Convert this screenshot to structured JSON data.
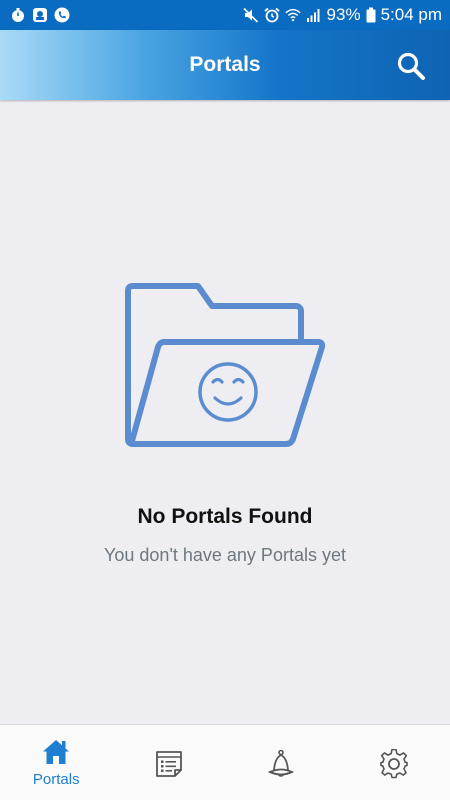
{
  "status_bar": {
    "battery": "93%",
    "time": "5:04 pm"
  },
  "app_bar": {
    "title": "Portals"
  },
  "empty_state": {
    "title": "No Portals Found",
    "subtitle": "You don't have any Portals yet"
  },
  "bottom_nav": {
    "items": [
      {
        "id": "portals",
        "label": "Portals",
        "icon": "home-icon",
        "active": true
      },
      {
        "id": "tasks",
        "label": "",
        "icon": "document-list-icon",
        "active": false
      },
      {
        "id": "notifications",
        "label": "",
        "icon": "bell-icon",
        "active": false
      },
      {
        "id": "settings",
        "label": "",
        "icon": "gear-icon",
        "active": false
      }
    ]
  },
  "colors": {
    "accent": "#1e7fd1",
    "illustration": "#5b8ccf",
    "status_bar": "#0a6cc0",
    "background": "#eeeef2"
  }
}
